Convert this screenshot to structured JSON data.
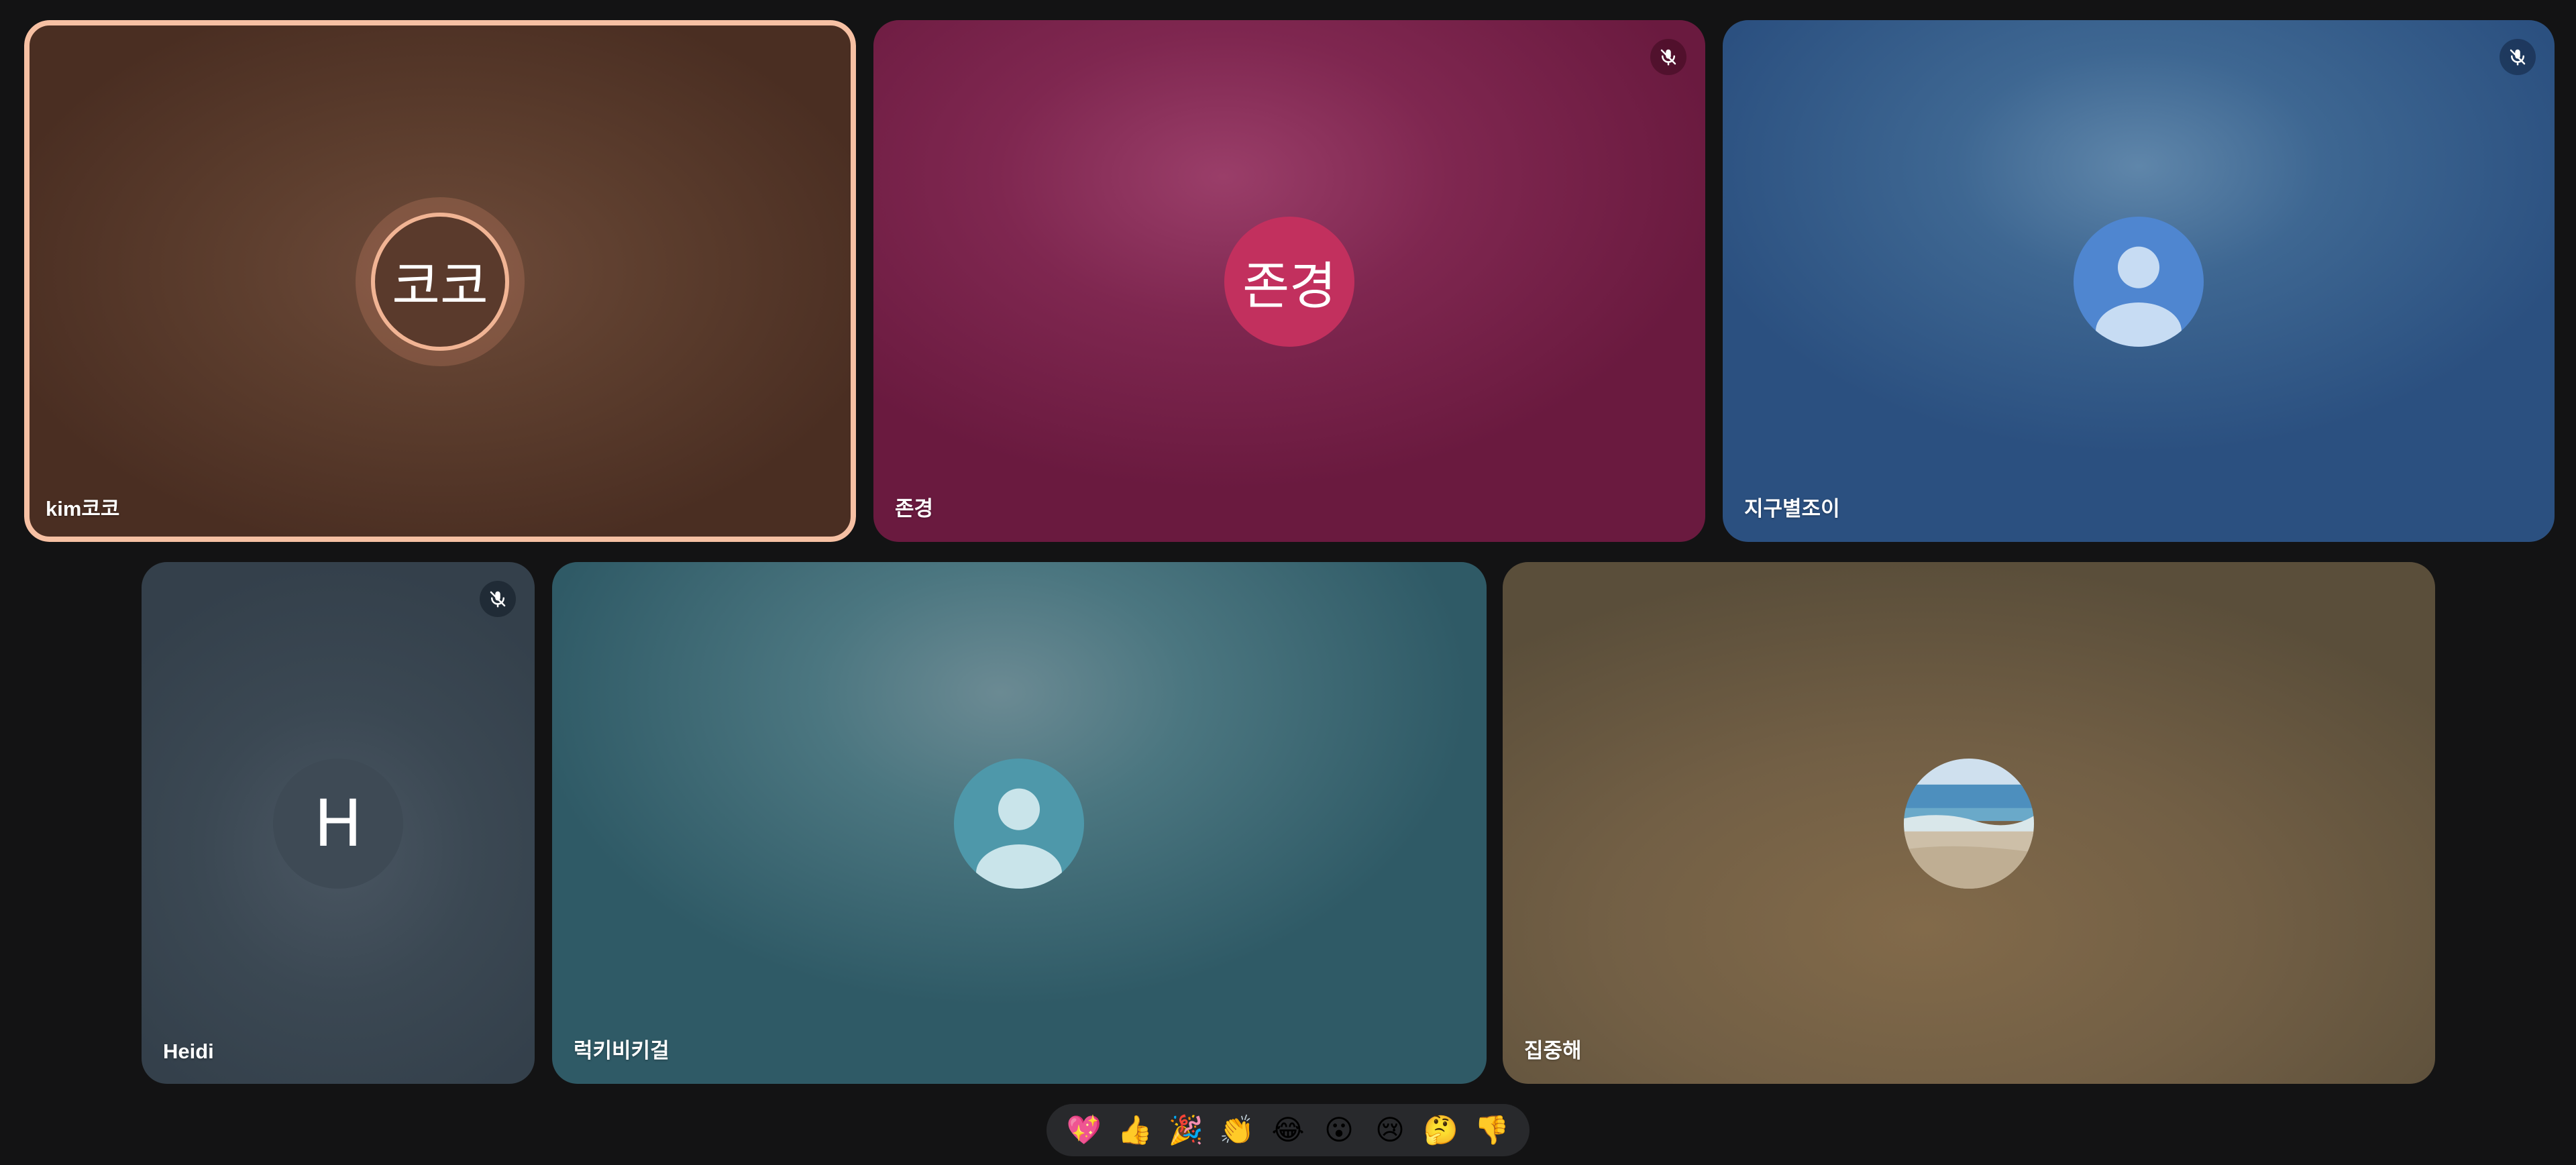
{
  "participants": [
    {
      "name": "kim코코",
      "avatar_text": "코코",
      "avatar_color": "#5a3a2c",
      "speaking": true,
      "muted": false
    },
    {
      "name": "존경",
      "avatar_text": "존경",
      "avatar_color": "#c2305e",
      "speaking": false,
      "muted": true
    },
    {
      "name": "지구별조이",
      "avatar_icon": "person-icon",
      "avatar_color": "#4f86d0",
      "speaking": false,
      "muted": true
    },
    {
      "name": "Heidi",
      "avatar_text": "H",
      "avatar_color": "#3e4a55",
      "speaking": false,
      "muted": true
    },
    {
      "name": "럭키비키걸",
      "avatar_icon": "person-icon",
      "avatar_color": "#4e98aa",
      "speaking": false,
      "muted": false
    },
    {
      "name": "집중해",
      "avatar_icon": "beach-photo",
      "speaking": false,
      "muted": false
    }
  ],
  "reactions": [
    {
      "name": "sparkling-heart",
      "glyph": "💖"
    },
    {
      "name": "thumbs-up",
      "glyph": "👍"
    },
    {
      "name": "party-popper",
      "glyph": "🎉"
    },
    {
      "name": "clapping-hands",
      "glyph": "👏"
    },
    {
      "name": "tears-of-joy",
      "glyph": "😂"
    },
    {
      "name": "surprised-face",
      "glyph": "😮"
    },
    {
      "name": "sad-face",
      "glyph": "😢"
    },
    {
      "name": "thinking-face",
      "glyph": "🤔"
    },
    {
      "name": "thumbs-down",
      "glyph": "👎"
    }
  ],
  "colors": {
    "speaking_border": "#f6c0a3",
    "background": "#131314",
    "reaction_bar": "#28292c"
  }
}
